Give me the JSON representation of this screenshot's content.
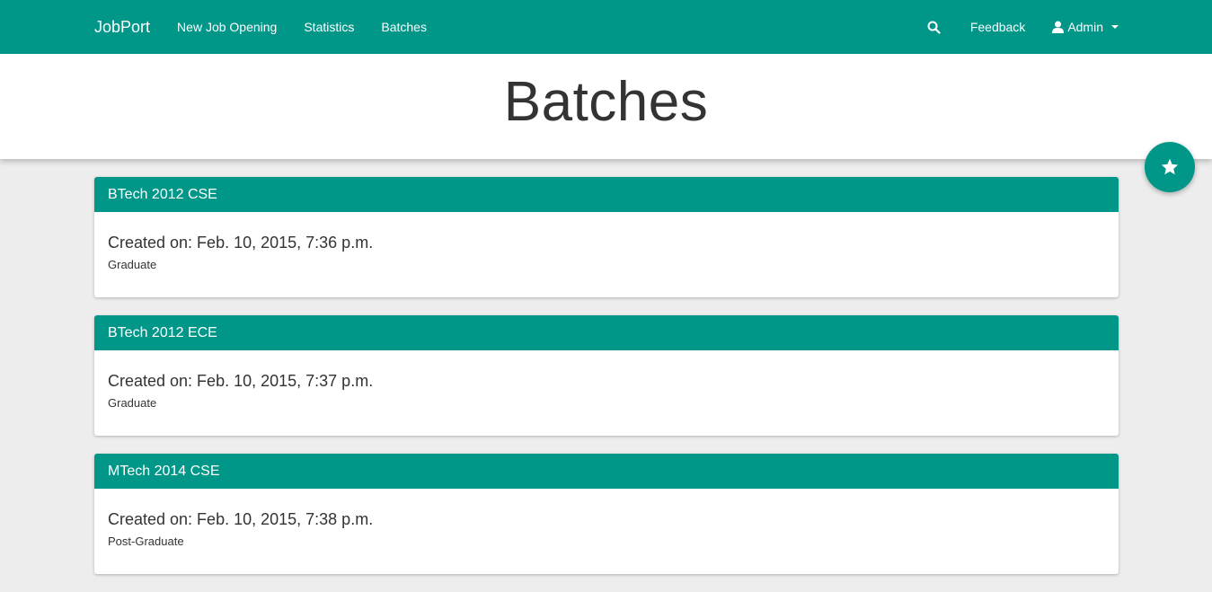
{
  "nav": {
    "brand": "JobPort",
    "links": [
      {
        "label": "New Job Opening"
      },
      {
        "label": "Statistics"
      },
      {
        "label": "Batches"
      }
    ],
    "search_icon": "search-icon",
    "feedback": "Feedback",
    "admin": "Admin",
    "admin_icon": "user-icon"
  },
  "page": {
    "title": "Batches"
  },
  "fab": {
    "icon": "star-icon"
  },
  "batches": [
    {
      "name": "BTech 2012 CSE",
      "created": "Created on: Feb. 10, 2015, 7:36 p.m.",
      "level": "Graduate"
    },
    {
      "name": "BTech 2012 ECE",
      "created": "Created on: Feb. 10, 2015, 7:37 p.m.",
      "level": "Graduate"
    },
    {
      "name": "MTech 2014 CSE",
      "created": "Created on: Feb. 10, 2015, 7:38 p.m.",
      "level": "Post-Graduate"
    }
  ],
  "colors": {
    "primary": "#009688",
    "background": "#ededed",
    "text": "#333333"
  }
}
